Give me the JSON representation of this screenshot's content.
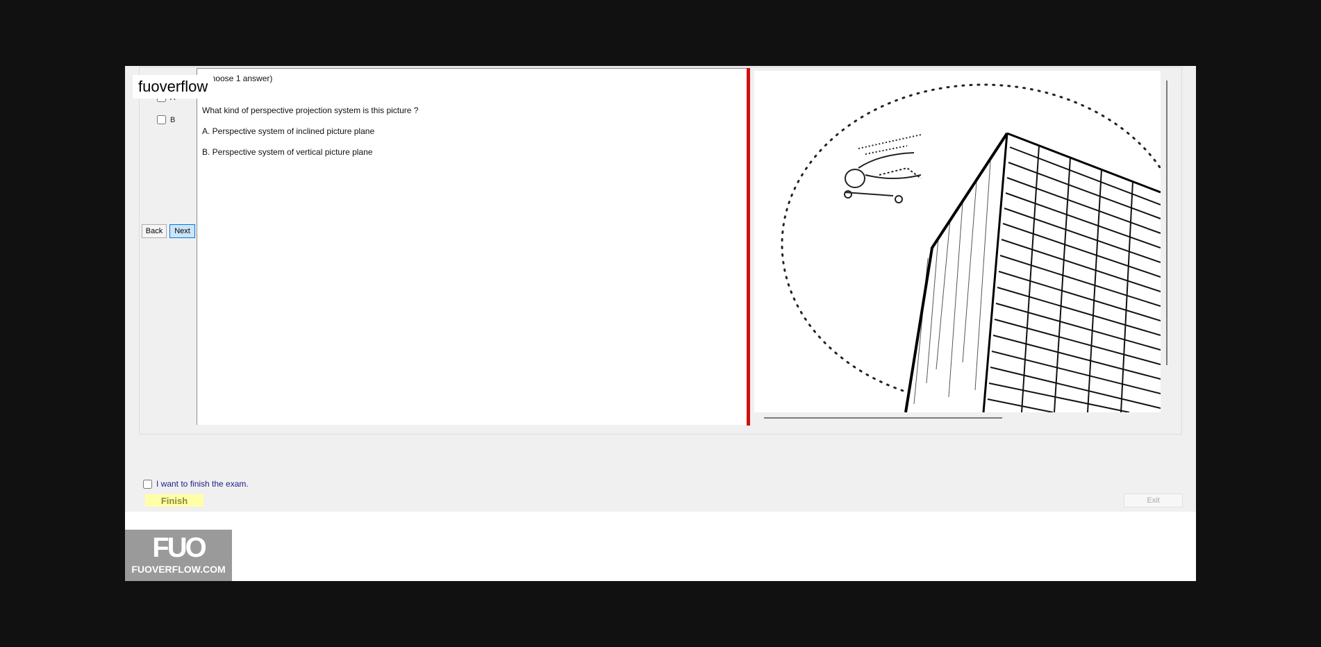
{
  "watermark": "fuoverflow",
  "answers": [
    {
      "label": "A"
    },
    {
      "label": "B"
    }
  ],
  "nav": {
    "back": "Back",
    "next": "Next"
  },
  "question": {
    "instruction": "(Choose 1 answer)",
    "text": "What kind of perspective projection system is this picture ?",
    "options": [
      "A.  Perspective system of inclined picture plane",
      "B.  Perspective system of vertical picture plane"
    ]
  },
  "image": {
    "description_icon": "skyscraper-perspective-drawing"
  },
  "finish": {
    "checkbox_label": "I want to finish the exam.",
    "button": "Finish"
  },
  "exit": "Exit",
  "logo": {
    "mark": "FUO",
    "site": "FUOVERFLOW.COM"
  },
  "colors": {
    "divider": "#d01010",
    "finish_bg": "#ffffa8",
    "next_bg": "#cce4f7"
  }
}
